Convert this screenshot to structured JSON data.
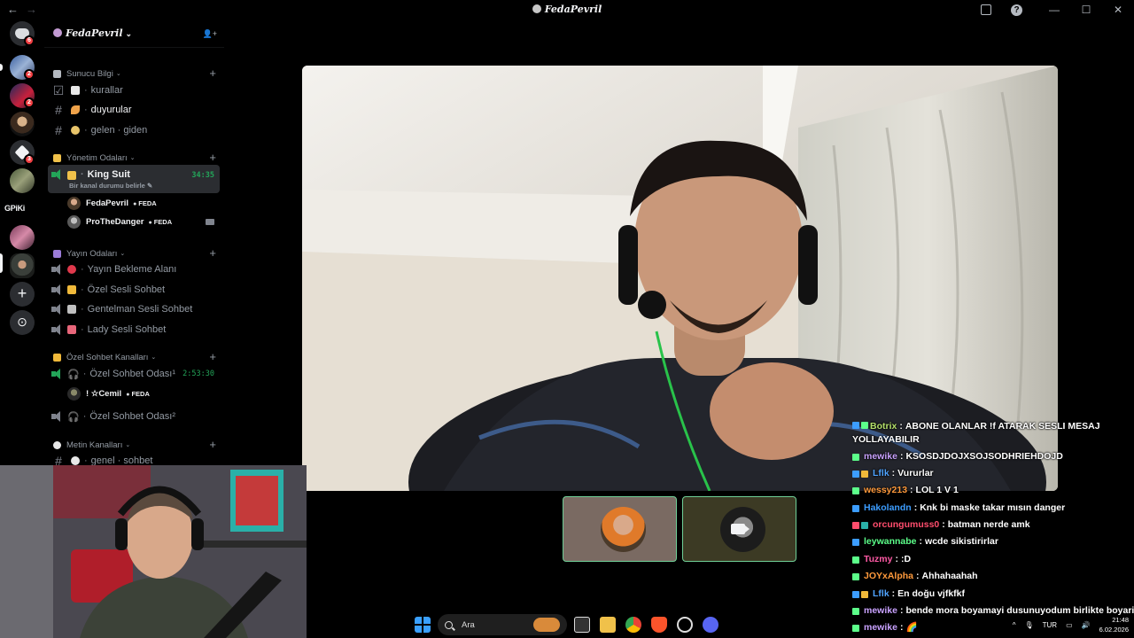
{
  "window": {
    "back_glyph": "←",
    "forward_glyph": "→",
    "title": "FedaPevril",
    "minimize": "—",
    "maximize": "☐",
    "close": "✕",
    "help_glyph": "?"
  },
  "rail": {
    "badges": [
      "6",
      "2",
      "2",
      "3"
    ],
    "text_server": "GPiKi",
    "add_glyph": "+",
    "discover_glyph": "⊙"
  },
  "server": {
    "name": "FedaPevril",
    "chevron": "⌄",
    "invite_glyph": "👤+"
  },
  "sidebar": {
    "categories": [
      {
        "label": "Sunucu Bilgi",
        "chevron": "⌄"
      },
      {
        "label": "Yönetim Odaları",
        "chevron": "⌄"
      },
      {
        "label": "Yayın Odaları",
        "chevron": "⌄"
      },
      {
        "label": "Özel Sohbet Kanalları",
        "chevron": "⌄"
      },
      {
        "label": "Metin Kanalları",
        "chevron": "⌄"
      }
    ],
    "channels": [
      {
        "name": "kurallar"
      },
      {
        "name": "duyurular"
      },
      {
        "name": "gelen · giden"
      },
      {
        "name": "King Suit",
        "time": "34:35",
        "status": "Bir kanal durumu belirle ✎"
      },
      {
        "name": "Yayın Bekleme Alanı"
      },
      {
        "name": "Özel Sesli Sohbet"
      },
      {
        "name": "Gentelman Sesli Sohbet"
      },
      {
        "name": "Lady Sesli Sohbet"
      },
      {
        "name": "Özel Sohbet Odası¹",
        "time": "2:53:30"
      },
      {
        "name": "Özel Sohbet Odası²"
      },
      {
        "name": "genel · sohbet"
      }
    ],
    "members": [
      {
        "name": "FedaPevril",
        "tag": "FEDA"
      },
      {
        "name": "ProTheDanger",
        "tag": "FEDA"
      },
      {
        "name": "! ☆Cemil",
        "tag": "FEDA"
      }
    ],
    "plus": "+"
  },
  "chat": {
    "messages": [
      {
        "user": "Botrix",
        "text": "ABONE OLANLAR !f ATARAK SESLI MESAJ YOLLAYABILIR",
        "color": "#b4e06b"
      },
      {
        "user": "mewike",
        "text": "KSOSDJDOJXSOJSODHRIEHDOJD",
        "color": "#c9a2ff"
      },
      {
        "user": "Lflk",
        "text": "Vururlar",
        "color": "#4fa3ff"
      },
      {
        "user": "wessy213",
        "text": "LOL 1 V 1",
        "color": "#ff9a3c"
      },
      {
        "user": "Hakolandn",
        "text": "Knk bi maske takar mısın danger",
        "color": "#3c9dff"
      },
      {
        "user": "orcungumuss0",
        "text": "batman nerde amk",
        "color": "#ff4d6d"
      },
      {
        "user": "leywannabe",
        "text": "wcde sikistirirlar",
        "color": "#5cff8a"
      },
      {
        "user": "Tuzmy",
        "text": ":D",
        "color": "#ff5aa5"
      },
      {
        "user": "JOYxAlpha",
        "text": "Ahhahaahah",
        "color": "#ff9a3c"
      },
      {
        "user": "Lflk",
        "text": "En doğu vjfkfkf",
        "color": "#4fa3ff"
      },
      {
        "user": "mewike",
        "text": "bende mora boyamayi dusunuyodum birlikte boyariz",
        "color": "#c9a2ff"
      },
      {
        "user": "mewike",
        "text": "🌈",
        "color": "#c9a2ff"
      }
    ]
  },
  "taskbar": {
    "search_placeholder": "Ara",
    "chevron_up": "^",
    "lang": "TUR",
    "time": "21:48",
    "date": "6.02.2026"
  }
}
